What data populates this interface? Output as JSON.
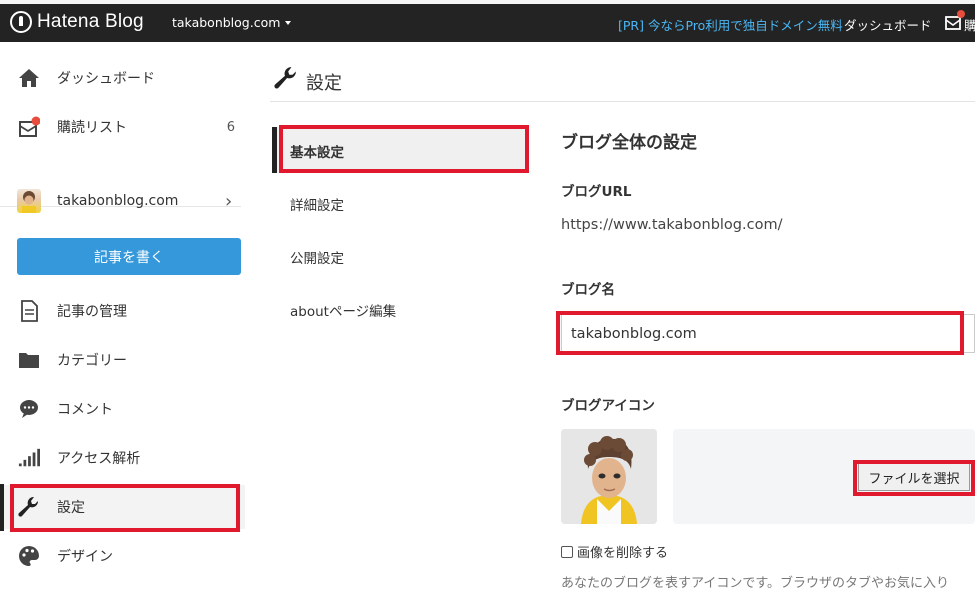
{
  "topbar": {
    "logo": "Hatena Blog",
    "blog_name": "takabonblog.com",
    "promo": "[PR] 今ならPro利用で独自ドメイン無料",
    "dashboard": "ダッシュボード",
    "subscribe_partial": "購"
  },
  "sidebar": {
    "dashboard": "ダッシュボード",
    "reading_list": "購読リスト",
    "reading_count": "6",
    "blog": "takabonblog.com",
    "write_button": "記事を書く",
    "items": [
      {
        "label": "記事の管理",
        "icon": "document-icon"
      },
      {
        "label": "カテゴリー",
        "icon": "folder-icon"
      },
      {
        "label": "コメント",
        "icon": "comment-icon"
      },
      {
        "label": "アクセス解析",
        "icon": "bar-chart-icon"
      },
      {
        "label": "設定",
        "icon": "wrench-icon"
      },
      {
        "label": "デザイン",
        "icon": "palette-icon"
      }
    ]
  },
  "main": {
    "title": "設定",
    "subnav": [
      "基本設定",
      "詳細設定",
      "公開設定",
      "aboutページ編集"
    ],
    "section_title": "ブログ全体の設定",
    "url_label": "ブログURL",
    "url_value": "https://www.takabonblog.com/",
    "name_label": "ブログ名",
    "name_value": "takabonblog.com",
    "icon_label": "ブログアイコン",
    "file_button": "ファイルを選択",
    "delete_label": "画像を削除する",
    "help_text": "あなたのブログを表すアイコンです。ブラウザのタブやお気に入り"
  },
  "colors": {
    "accent": "#3498db",
    "highlight": "#e0192f",
    "topbar": "#232323",
    "promo": "#4ab7f5"
  }
}
